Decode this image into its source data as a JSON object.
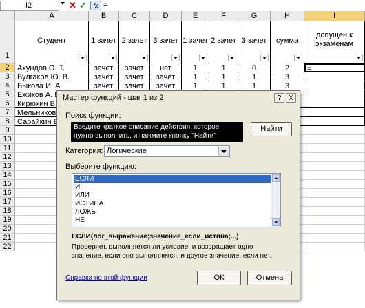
{
  "formula_bar": {
    "name_box": "I2",
    "cancel_icon": "✕",
    "enter_icon": "✓",
    "fx_label": "fx",
    "formula": "="
  },
  "columns": [
    "A",
    "B",
    "C",
    "D",
    "E",
    "F",
    "G",
    "H",
    "I"
  ],
  "rows": [
    "1",
    "2",
    "3",
    "4",
    "5",
    "6",
    "7",
    "8",
    "9",
    "10",
    "11",
    "12",
    "13",
    "14",
    "15",
    "16",
    "17",
    "18",
    "19",
    "20",
    "21",
    "22"
  ],
  "header_row": [
    "Студент",
    "1 зачет",
    "2 зачет",
    "3 зачет",
    "1 зачет",
    "2 зачет",
    "3 зачет",
    "сумма",
    "допущен к экзаменам"
  ],
  "data_rows": [
    [
      "Ахундов О. Т.",
      "зачет",
      "зачет",
      "нет",
      "1",
      "1",
      "0",
      "2",
      "="
    ],
    [
      "Булгаков Ю. В.",
      "зачет",
      "зачет",
      "зачет",
      "1",
      "1",
      "1",
      "3",
      ""
    ],
    [
      "Быкова И. А.",
      "зачет",
      "зачет",
      "зачет",
      "1",
      "1",
      "1",
      "3",
      ""
    ],
    [
      "Ежиков А. В.",
      "",
      "",
      "",
      "",
      "",
      "",
      "",
      ""
    ],
    [
      "Кирюхин В.",
      "",
      "",
      "",
      "",
      "",
      "",
      "",
      ""
    ],
    [
      "Мельников",
      "",
      "",
      "",
      "",
      "",
      "",
      "",
      ""
    ],
    [
      "Сарайкин Е.",
      "",
      "",
      "",
      "",
      "",
      "",
      "",
      ""
    ]
  ],
  "dialog": {
    "title": "Мастер функций - шаг 1 из 2",
    "help_btn": "?",
    "close_btn": "X",
    "search_label": "Поиск функции:",
    "search_text": "Введите краткое описание действия, которое нужно выполнить, и нажмите кнопку \"Найти\"",
    "find_button": "Найти",
    "category_label": "Категория:",
    "category_value": "Логические",
    "select_label": "Выберите функцию:",
    "functions": [
      "ЕСЛИ",
      "И",
      "ИЛИ",
      "ИСТИНА",
      "ЛОЖЬ",
      "НЕ"
    ],
    "selected_function": "ЕСЛИ",
    "signature": "ЕСЛИ(лог_выражение;значение_если_истина;...)",
    "description": "Проверяет, выполняется ли условие, и возвращает одно значение, если оно выполняется, и другое значение, если нет.",
    "help_link": "Справка по этой функции",
    "ok_button": "ОК",
    "cancel_button": "Отмена"
  }
}
